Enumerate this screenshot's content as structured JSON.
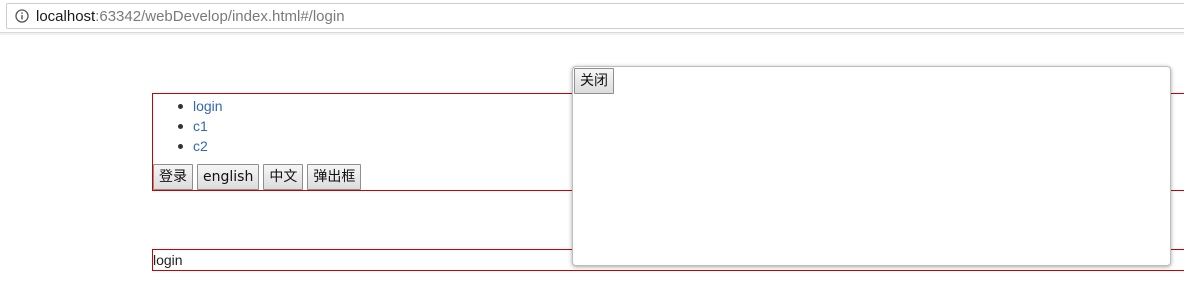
{
  "browser": {
    "url_host": "localhost",
    "url_rest": ":63342/webDevelop/index.html#/login"
  },
  "nav": {
    "links": [
      {
        "label": "login"
      },
      {
        "label": "c1"
      },
      {
        "label": "c2"
      }
    ]
  },
  "buttons": {
    "login": "登录",
    "english": "english",
    "chinese": "中文",
    "popup": "弹出框"
  },
  "view": {
    "text": "login"
  },
  "modal": {
    "close_label": "关闭"
  },
  "colors": {
    "border_red": "#cc0000",
    "link_blue": "#3366bb"
  }
}
